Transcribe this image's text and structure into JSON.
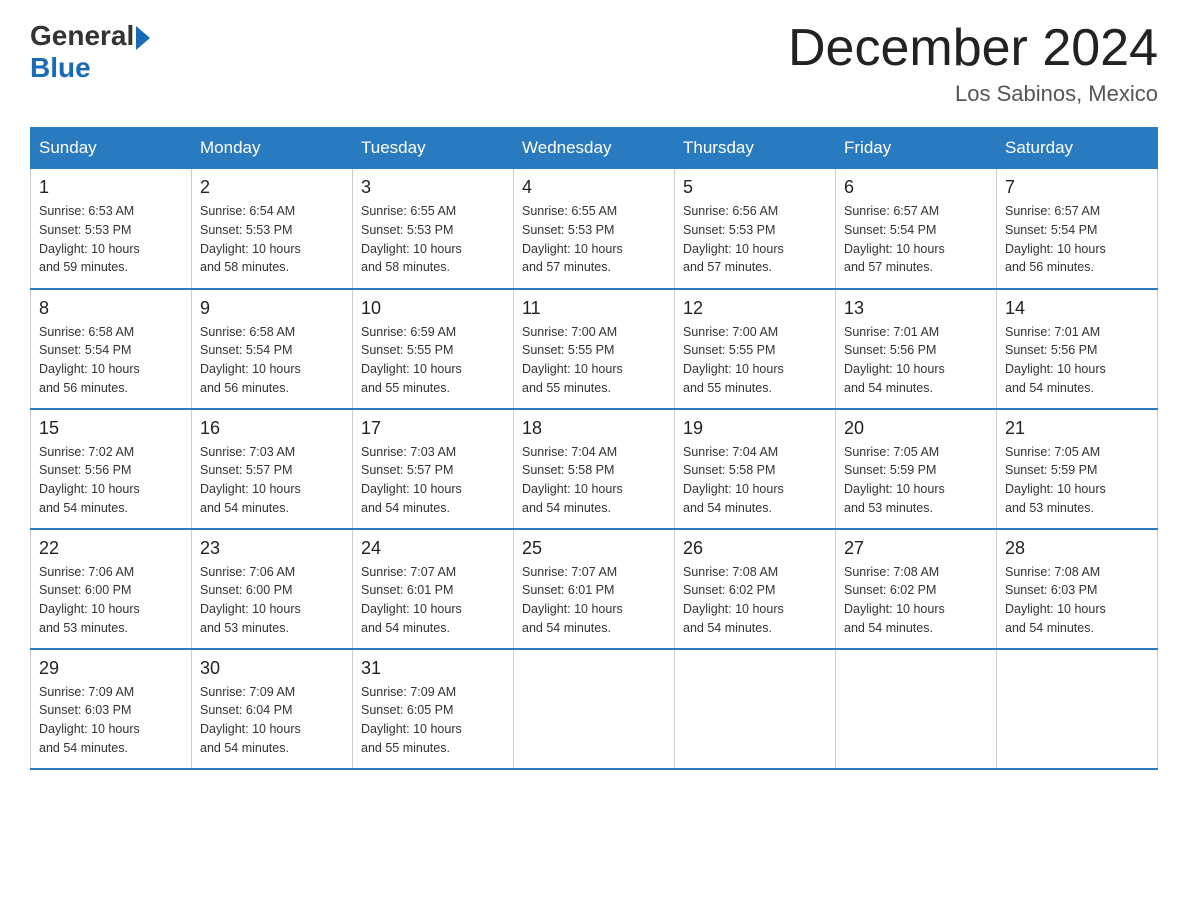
{
  "header": {
    "logo_general": "General",
    "logo_blue": "Blue",
    "title": "December 2024",
    "location": "Los Sabinos, Mexico"
  },
  "days_of_week": [
    "Sunday",
    "Monday",
    "Tuesday",
    "Wednesday",
    "Thursday",
    "Friday",
    "Saturday"
  ],
  "weeks": [
    [
      {
        "day": "1",
        "sunrise": "6:53 AM",
        "sunset": "5:53 PM",
        "daylight": "10 hours and 59 minutes."
      },
      {
        "day": "2",
        "sunrise": "6:54 AM",
        "sunset": "5:53 PM",
        "daylight": "10 hours and 58 minutes."
      },
      {
        "day": "3",
        "sunrise": "6:55 AM",
        "sunset": "5:53 PM",
        "daylight": "10 hours and 58 minutes."
      },
      {
        "day": "4",
        "sunrise": "6:55 AM",
        "sunset": "5:53 PM",
        "daylight": "10 hours and 57 minutes."
      },
      {
        "day": "5",
        "sunrise": "6:56 AM",
        "sunset": "5:53 PM",
        "daylight": "10 hours and 57 minutes."
      },
      {
        "day": "6",
        "sunrise": "6:57 AM",
        "sunset": "5:54 PM",
        "daylight": "10 hours and 57 minutes."
      },
      {
        "day": "7",
        "sunrise": "6:57 AM",
        "sunset": "5:54 PM",
        "daylight": "10 hours and 56 minutes."
      }
    ],
    [
      {
        "day": "8",
        "sunrise": "6:58 AM",
        "sunset": "5:54 PM",
        "daylight": "10 hours and 56 minutes."
      },
      {
        "day": "9",
        "sunrise": "6:58 AM",
        "sunset": "5:54 PM",
        "daylight": "10 hours and 56 minutes."
      },
      {
        "day": "10",
        "sunrise": "6:59 AM",
        "sunset": "5:55 PM",
        "daylight": "10 hours and 55 minutes."
      },
      {
        "day": "11",
        "sunrise": "7:00 AM",
        "sunset": "5:55 PM",
        "daylight": "10 hours and 55 minutes."
      },
      {
        "day": "12",
        "sunrise": "7:00 AM",
        "sunset": "5:55 PM",
        "daylight": "10 hours and 55 minutes."
      },
      {
        "day": "13",
        "sunrise": "7:01 AM",
        "sunset": "5:56 PM",
        "daylight": "10 hours and 54 minutes."
      },
      {
        "day": "14",
        "sunrise": "7:01 AM",
        "sunset": "5:56 PM",
        "daylight": "10 hours and 54 minutes."
      }
    ],
    [
      {
        "day": "15",
        "sunrise": "7:02 AM",
        "sunset": "5:56 PM",
        "daylight": "10 hours and 54 minutes."
      },
      {
        "day": "16",
        "sunrise": "7:03 AM",
        "sunset": "5:57 PM",
        "daylight": "10 hours and 54 minutes."
      },
      {
        "day": "17",
        "sunrise": "7:03 AM",
        "sunset": "5:57 PM",
        "daylight": "10 hours and 54 minutes."
      },
      {
        "day": "18",
        "sunrise": "7:04 AM",
        "sunset": "5:58 PM",
        "daylight": "10 hours and 54 minutes."
      },
      {
        "day": "19",
        "sunrise": "7:04 AM",
        "sunset": "5:58 PM",
        "daylight": "10 hours and 54 minutes."
      },
      {
        "day": "20",
        "sunrise": "7:05 AM",
        "sunset": "5:59 PM",
        "daylight": "10 hours and 53 minutes."
      },
      {
        "day": "21",
        "sunrise": "7:05 AM",
        "sunset": "5:59 PM",
        "daylight": "10 hours and 53 minutes."
      }
    ],
    [
      {
        "day": "22",
        "sunrise": "7:06 AM",
        "sunset": "6:00 PM",
        "daylight": "10 hours and 53 minutes."
      },
      {
        "day": "23",
        "sunrise": "7:06 AM",
        "sunset": "6:00 PM",
        "daylight": "10 hours and 53 minutes."
      },
      {
        "day": "24",
        "sunrise": "7:07 AM",
        "sunset": "6:01 PM",
        "daylight": "10 hours and 54 minutes."
      },
      {
        "day": "25",
        "sunrise": "7:07 AM",
        "sunset": "6:01 PM",
        "daylight": "10 hours and 54 minutes."
      },
      {
        "day": "26",
        "sunrise": "7:08 AM",
        "sunset": "6:02 PM",
        "daylight": "10 hours and 54 minutes."
      },
      {
        "day": "27",
        "sunrise": "7:08 AM",
        "sunset": "6:02 PM",
        "daylight": "10 hours and 54 minutes."
      },
      {
        "day": "28",
        "sunrise": "7:08 AM",
        "sunset": "6:03 PM",
        "daylight": "10 hours and 54 minutes."
      }
    ],
    [
      {
        "day": "29",
        "sunrise": "7:09 AM",
        "sunset": "6:03 PM",
        "daylight": "10 hours and 54 minutes."
      },
      {
        "day": "30",
        "sunrise": "7:09 AM",
        "sunset": "6:04 PM",
        "daylight": "10 hours and 54 minutes."
      },
      {
        "day": "31",
        "sunrise": "7:09 AM",
        "sunset": "6:05 PM",
        "daylight": "10 hours and 55 minutes."
      },
      null,
      null,
      null,
      null
    ]
  ],
  "labels": {
    "sunrise": "Sunrise:",
    "sunset": "Sunset:",
    "daylight": "Daylight:"
  }
}
